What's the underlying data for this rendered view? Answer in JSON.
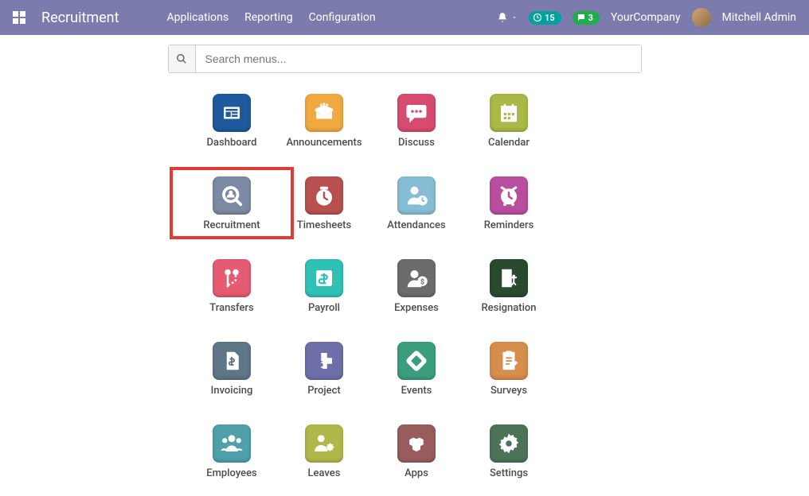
{
  "header": {
    "title": "Recruitment",
    "nav": [
      "Applications",
      "Reporting",
      "Configuration"
    ],
    "activity_badge": "15",
    "discuss_badge": "3",
    "company": "YourCompany",
    "user": "Mitchell Admin"
  },
  "search": {
    "placeholder": "Search menus..."
  },
  "apps": [
    {
      "label": "Dashboard",
      "icon": "dashboard-icon",
      "bg": "bg-dashboard"
    },
    {
      "label": "Announcements",
      "icon": "announcements-icon",
      "bg": "bg-announcements"
    },
    {
      "label": "Discuss",
      "icon": "discuss-icon",
      "bg": "bg-discuss"
    },
    {
      "label": "Calendar",
      "icon": "calendar-icon",
      "bg": "bg-calendar"
    },
    {
      "label": "Recruitment",
      "icon": "recruitment-icon",
      "bg": "bg-recruitment",
      "highlighted": true
    },
    {
      "label": "Timesheets",
      "icon": "timesheets-icon",
      "bg": "bg-timesheets"
    },
    {
      "label": "Attendances",
      "icon": "attendances-icon",
      "bg": "bg-attendances"
    },
    {
      "label": "Reminders",
      "icon": "reminders-icon",
      "bg": "bg-reminders"
    },
    {
      "label": "Transfers",
      "icon": "transfers-icon",
      "bg": "bg-transfers"
    },
    {
      "label": "Payroll",
      "icon": "payroll-icon",
      "bg": "bg-payroll"
    },
    {
      "label": "Expenses",
      "icon": "expenses-icon",
      "bg": "bg-expenses"
    },
    {
      "label": "Resignation",
      "icon": "resignation-icon",
      "bg": "bg-resignation"
    },
    {
      "label": "Invoicing",
      "icon": "invoicing-icon",
      "bg": "bg-invoicing"
    },
    {
      "label": "Project",
      "icon": "project-icon",
      "bg": "bg-project"
    },
    {
      "label": "Events",
      "icon": "events-icon",
      "bg": "bg-events"
    },
    {
      "label": "Surveys",
      "icon": "surveys-icon",
      "bg": "bg-surveys"
    },
    {
      "label": "Employees",
      "icon": "employees-icon",
      "bg": "bg-employees"
    },
    {
      "label": "Leaves",
      "icon": "leaves-icon",
      "bg": "bg-leaves"
    },
    {
      "label": "Apps",
      "icon": "apps-icon",
      "bg": "bg-apps"
    },
    {
      "label": "Settings",
      "icon": "settings-icon",
      "bg": "bg-settings"
    }
  ]
}
